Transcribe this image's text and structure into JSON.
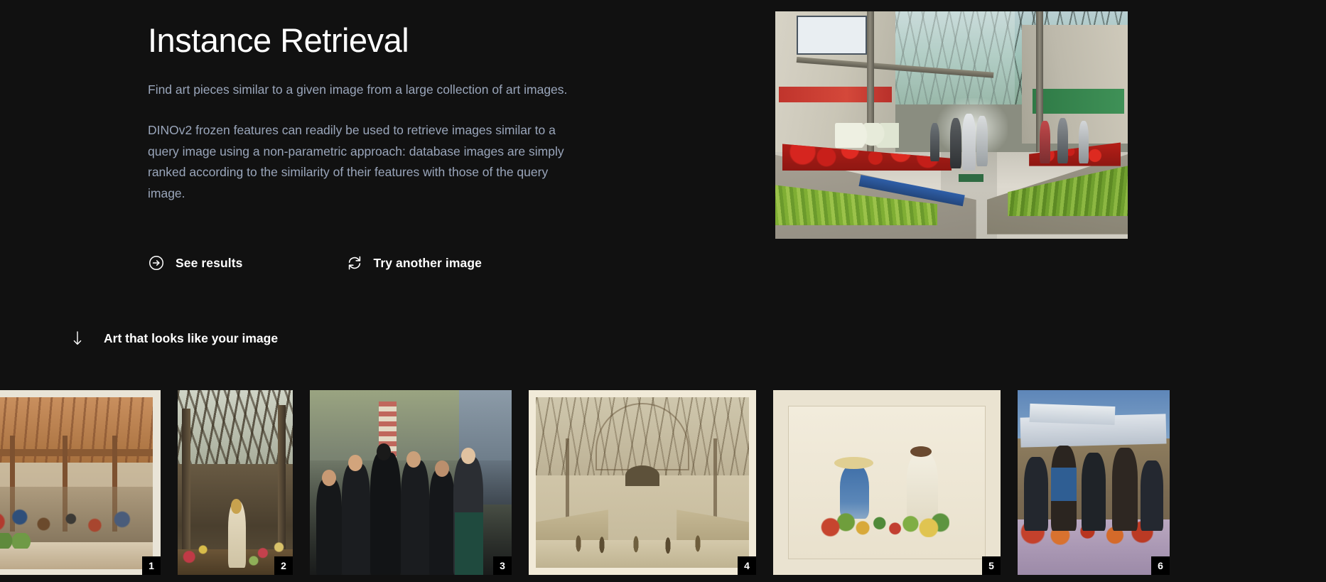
{
  "hero": {
    "title": "Instance Retrieval",
    "lead": "Find art pieces similar to a given image from a large collection of art images.",
    "body": "DINOv2 frozen features can readily be used to retrieve images similar to a query image using a non-parametric approach: database images are simply ranked according to the similarity of their features with those of the query image."
  },
  "actions": {
    "see_results": {
      "label": "See results",
      "icon": "arrow-right-circle-icon"
    },
    "try_another": {
      "label": "Try another image",
      "icon": "refresh-icon"
    }
  },
  "query_image": {
    "alt": "Indoor vegetable market hall with produce stalls and shoppers"
  },
  "section": {
    "title": "Art that looks like your image",
    "icon": "arrow-down-icon"
  },
  "results": [
    {
      "badge": "1",
      "alt": "Watercolour of a covered market crowd under a timber roof"
    },
    {
      "badge": "2",
      "alt": "Impressionist flower market inside a glasshouse"
    },
    {
      "badge": "3",
      "alt": "Dark expressionist painting of figures at a market"
    },
    {
      "badge": "4",
      "alt": "Sepia engraving of a large market hall interior"
    },
    {
      "badge": "5",
      "alt": "Pale watercolour of two figures sorting vegetables"
    },
    {
      "badge": "6",
      "alt": "Fauvist market scene under a white awning"
    }
  ],
  "colors": {
    "background": "#111111",
    "title": "#ffffff",
    "body_text": "#9aa6bb",
    "badge_bg": "#000000",
    "badge_text": "#ffffff"
  }
}
